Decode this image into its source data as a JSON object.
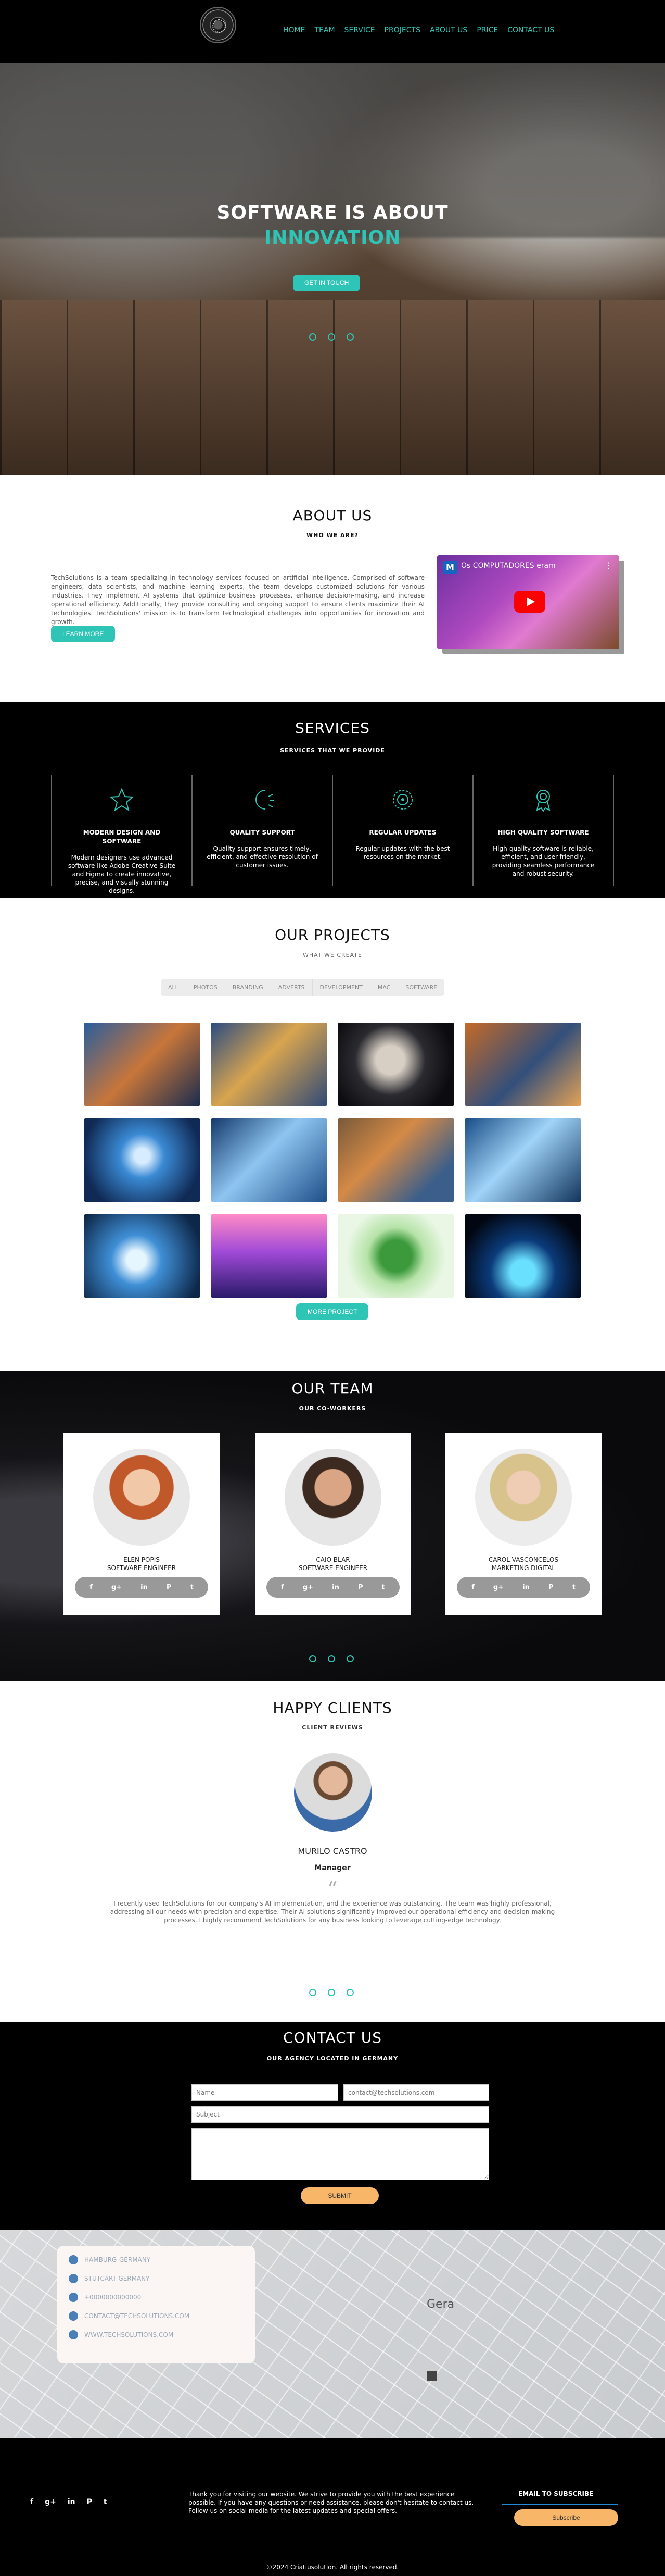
{
  "nav": {
    "links": [
      "HOME",
      "TEAM",
      "SERVICE",
      "PROJECTS",
      "ABOUT US",
      "PRICE",
      "CONTACT US"
    ]
  },
  "hero": {
    "line1": "SOFTWARE IS ABOUT",
    "line2": "INNOVATION",
    "cta": "GET IN TOUCH"
  },
  "about": {
    "title": "ABOUT US",
    "subtitle": "WHO WE ARE?",
    "text": "TechSolutions is a team specializing in technology services focused on artificial intelligence. Comprised of software engineers, data scientists, and machine learning experts, the team develops customized solutions for various industries. They implement AI systems that optimize business processes, enhance decision-making, and increase operational efficiency. Additionally, they provide consulting and ongoing support to ensure clients maximize their AI technologies. TechSolutions' mission is to transform technological challenges into opportunities for innovation and growth.",
    "button": "LEARN MORE",
    "video": {
      "logo": "M",
      "title": "Os COMPUTADORES eram"
    }
  },
  "services": {
    "title": "SERVICES",
    "subtitle": "SERVICES THAT WE PROVIDE",
    "items": [
      {
        "icon": "star-icon",
        "title": "MODERN DESIGN AND SOFTWARE",
        "text": "Modern designers use advanced software like Adobe Creative Suite and Figma to create innovative, precise, and visually stunning designs."
      },
      {
        "icon": "moon-icon",
        "title": "QUALITY SUPPORT",
        "text": "Quality support ensures timely, efficient, and effective resolution of customer issues."
      },
      {
        "icon": "gauge-icon",
        "title": "REGULAR UPDATES",
        "text": "Regular updates with the best resources on the market."
      },
      {
        "icon": "award-icon",
        "title": "HIGH QUALITY SOFTWARE",
        "text": "High-quality software is reliable, efficient, and user-friendly, providing seamless performance and robust security."
      }
    ]
  },
  "projects": {
    "title": "OUR PROJECTS",
    "subtitle": "WHAT WE CREATE",
    "filters": [
      "ALL",
      "PHOTOS",
      "BRANDING",
      "ADVERTS",
      "DEVELOPMENT",
      "MAC",
      "SOFTWARE"
    ],
    "button": "MORE PROJECT"
  },
  "team": {
    "title": "OUR TEAM",
    "subtitle": "OUR CO-WORKERS",
    "members": [
      {
        "name": "ELEN POPIS",
        "role": "SOFTWARE ENGINEER"
      },
      {
        "name": "CAIO BLAR",
        "role": "SOFTWARE ENGINEER"
      },
      {
        "name": "CAROL VASCONCELOS",
        "role": "MARKETING DIGITAL"
      }
    ],
    "social": [
      "f",
      "g+",
      "in",
      "P",
      "t"
    ]
  },
  "clients": {
    "title": "HAPPY CLIENTS",
    "subtitle": "CLIENT REVIEWS",
    "name": "MURILO CASTRO",
    "role": "Manager",
    "quote_mark": "“",
    "text": "I recently used TechSolutions for our company's AI implementation, and the experience was outstanding. The team was highly professional, addressing all our needs with precision and expertise. Their AI solutions significantly improved our operational efficiency and decision-making processes. I highly recommend TechSolutions for any business looking to leverage cutting-edge technology."
  },
  "contact": {
    "title": "CONTACT US",
    "subtitle": "OUR AGENCY LOCATED IN GERMANY",
    "name_ph": "Name",
    "email_ph": "contact@techsolutions.com",
    "subject_ph": "Subject",
    "submit": "SUBMIT"
  },
  "map": {
    "city": "Gera",
    "items": [
      "HAMBURG-GERMANY",
      "STUTCART-GERMANY",
      "+0000000000000",
      "CONTACT@TECHSOLUTIONS.COM",
      "WWW.TECHSOLUTIONS.COM"
    ]
  },
  "footer": {
    "social": [
      "f",
      "g+",
      "in",
      "P",
      "t"
    ],
    "text": "Thank you for visiting our website. We strive to provide you with the best experience possible. If you have any questions or need assistance, please don't hesitate to contact us. Follow us on social media for the latest updates and special offers.",
    "newsletter_title": "EMAIL TO SUBSCRIBE",
    "subscribe": "Subscribe",
    "copyright": "©2024 Criatiusolution. All rights reserved."
  }
}
